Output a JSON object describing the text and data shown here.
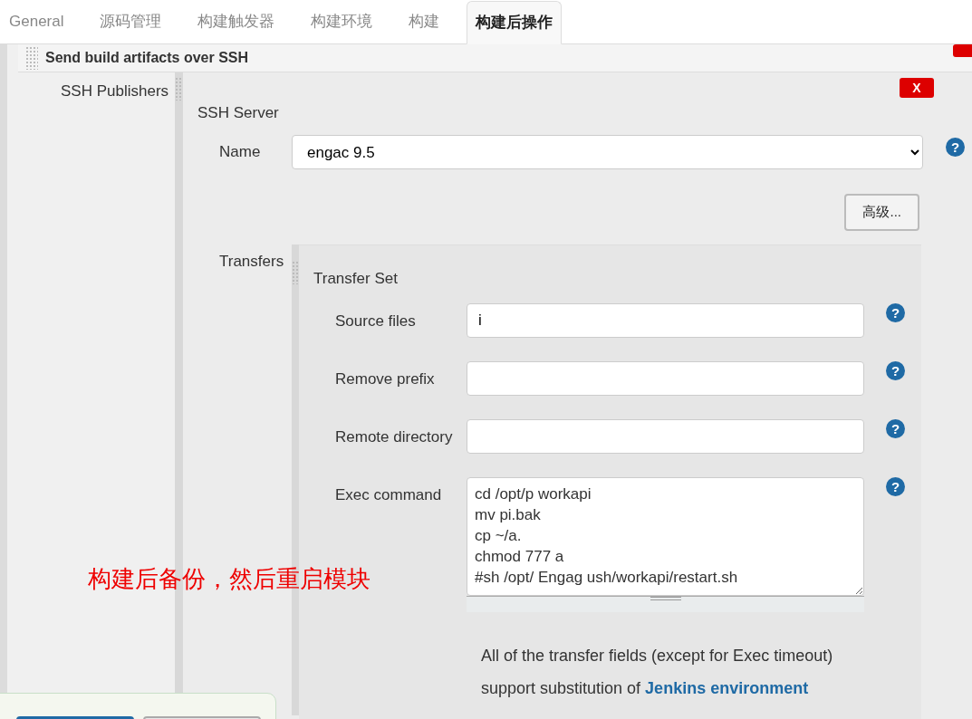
{
  "tabs": [
    {
      "label": "General",
      "selected": false
    },
    {
      "label": "源码管理",
      "selected": false
    },
    {
      "label": "构建触发器",
      "selected": false
    },
    {
      "label": "构建环境",
      "selected": false
    },
    {
      "label": "构建",
      "selected": false
    },
    {
      "label": "构建后操作",
      "selected": true
    }
  ],
  "section": {
    "title": "Send build artifacts over SSH"
  },
  "publishers": {
    "label": "SSH Publishers",
    "delete": "X",
    "server": {
      "title": "SSH Server",
      "name_label": "Name",
      "name_value": "engac 9.5",
      "help": "?",
      "advanced": "高级..."
    },
    "transfers": {
      "label": "Transfers",
      "title": "Transfer Set",
      "fields": [
        {
          "kind": "input",
          "label": "Source files",
          "value": "i",
          "help": "?"
        },
        {
          "kind": "input",
          "label": "Remove prefix",
          "help": "?"
        },
        {
          "kind": "input",
          "label": "Remote directory",
          "help": "?"
        },
        {
          "kind": "textarea",
          "label": "Exec command",
          "lines": [
            "cd /opt/p workapi",
            "mv pi.bak",
            "cp ~/a.",
            "chmod 777 a",
            "#sh /opt/ Engag ush/workapi/restart.sh"
          ],
          "help": "?"
        }
      ],
      "note": "All of the transfer fields (except for Exec timeout) support substitution of ",
      "note_link": "Jenkins environment"
    }
  },
  "annotation": "构建后备份，然后重启模块"
}
